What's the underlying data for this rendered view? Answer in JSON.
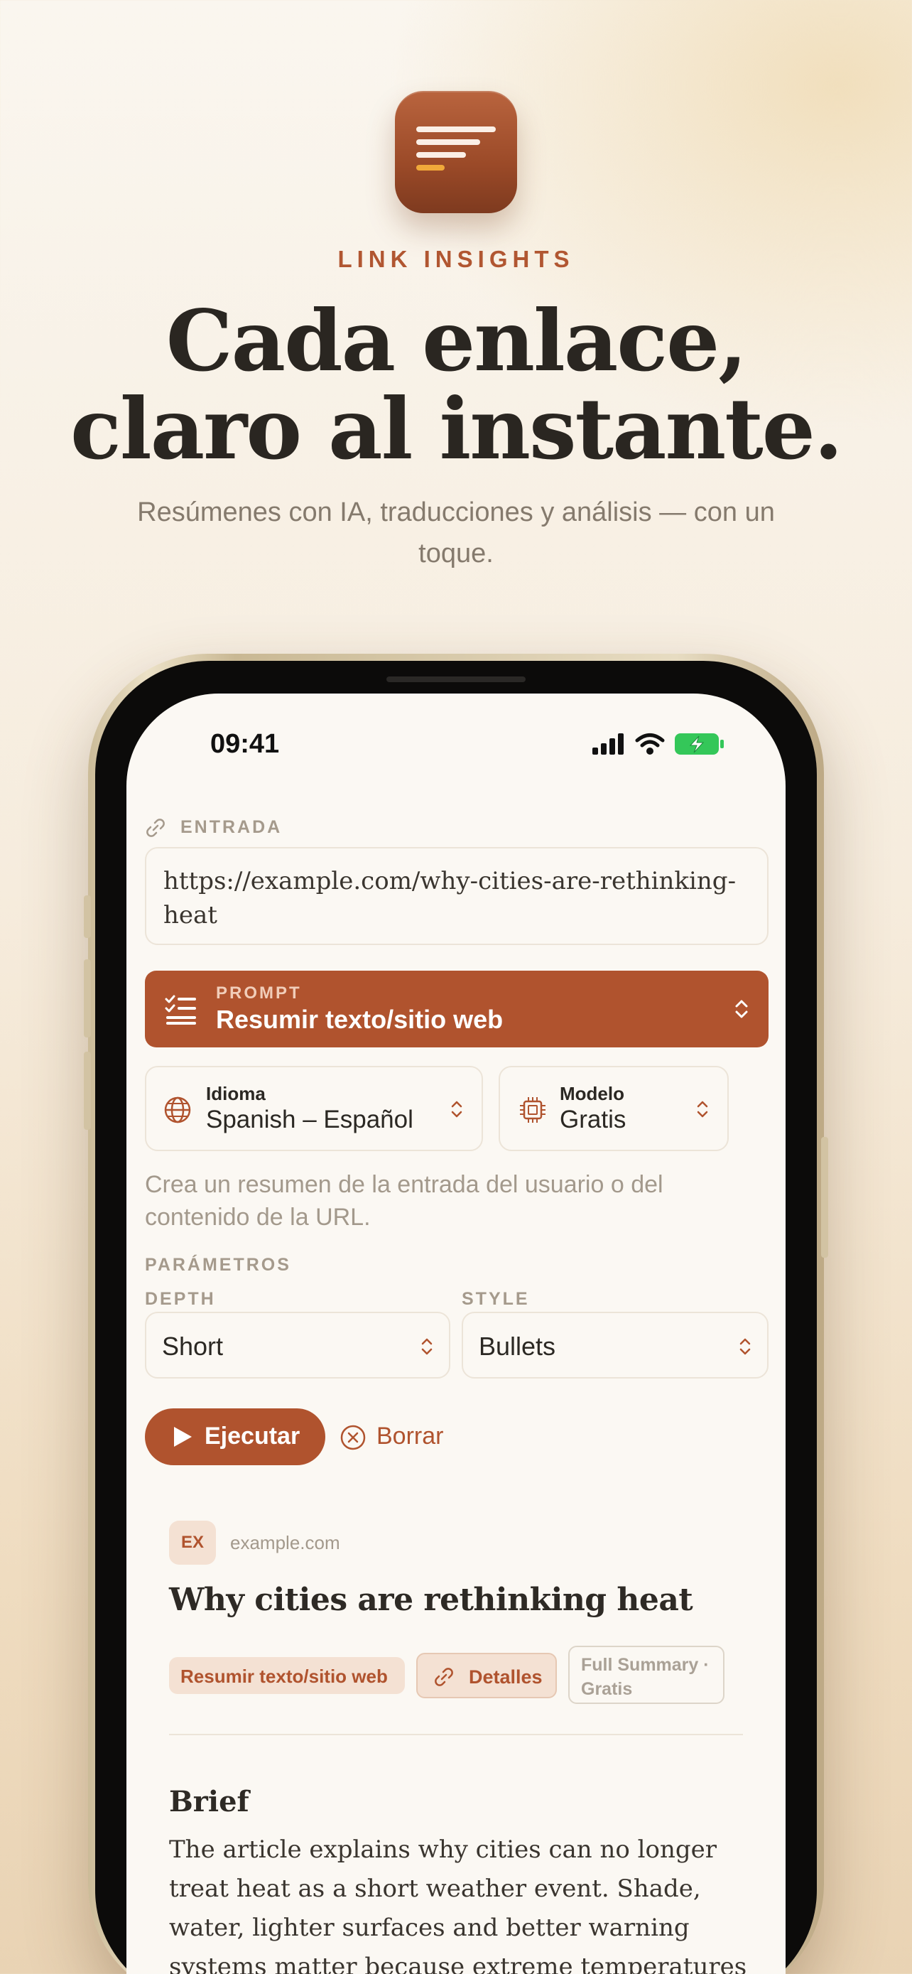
{
  "brand": {
    "name": "LINK INSIGHTS",
    "accent": "#b0532e"
  },
  "hero": {
    "headline_line1": "Cada enlace,",
    "headline_line2": "claro al instante.",
    "subhead": "Resúmenes con IA, traducciones y análisis — con un toque."
  },
  "status_bar": {
    "time": "09:41",
    "battery_state": "charging"
  },
  "input_section": {
    "label": "ENTRADA",
    "url_value": "https://example.com/why-cities-are-rethinking-heat"
  },
  "prompt": {
    "kicker": "PROMPT",
    "value": "Resumir texto/sitio web"
  },
  "language_picker": {
    "title": "Idioma",
    "value": "Spanish – Español"
  },
  "model_picker": {
    "title": "Modelo",
    "value": "Gratis"
  },
  "description": "Crea un resumen de la entrada del usuario o del contenido de la URL.",
  "params": {
    "label": "PARÁMETROS",
    "depth": {
      "label": "DEPTH",
      "value": "Short"
    },
    "style": {
      "label": "STYLE",
      "value": "Bullets"
    }
  },
  "actions": {
    "run_label": "Ejecutar",
    "clear_label": "Borrar"
  },
  "result": {
    "favicon": "EX",
    "domain": "example.com",
    "title": "Why cities are rethinking heat",
    "chips": {
      "prompt": "Resumir texto/sitio web",
      "details": "Detalles",
      "model": "Full Summary · Gratis"
    },
    "brief_heading": "Brief",
    "brief_body": "The article explains why cities can no longer treat heat as a short weather event. Shade, water, lighter surfaces and better warning systems matter because extreme temperatures"
  }
}
